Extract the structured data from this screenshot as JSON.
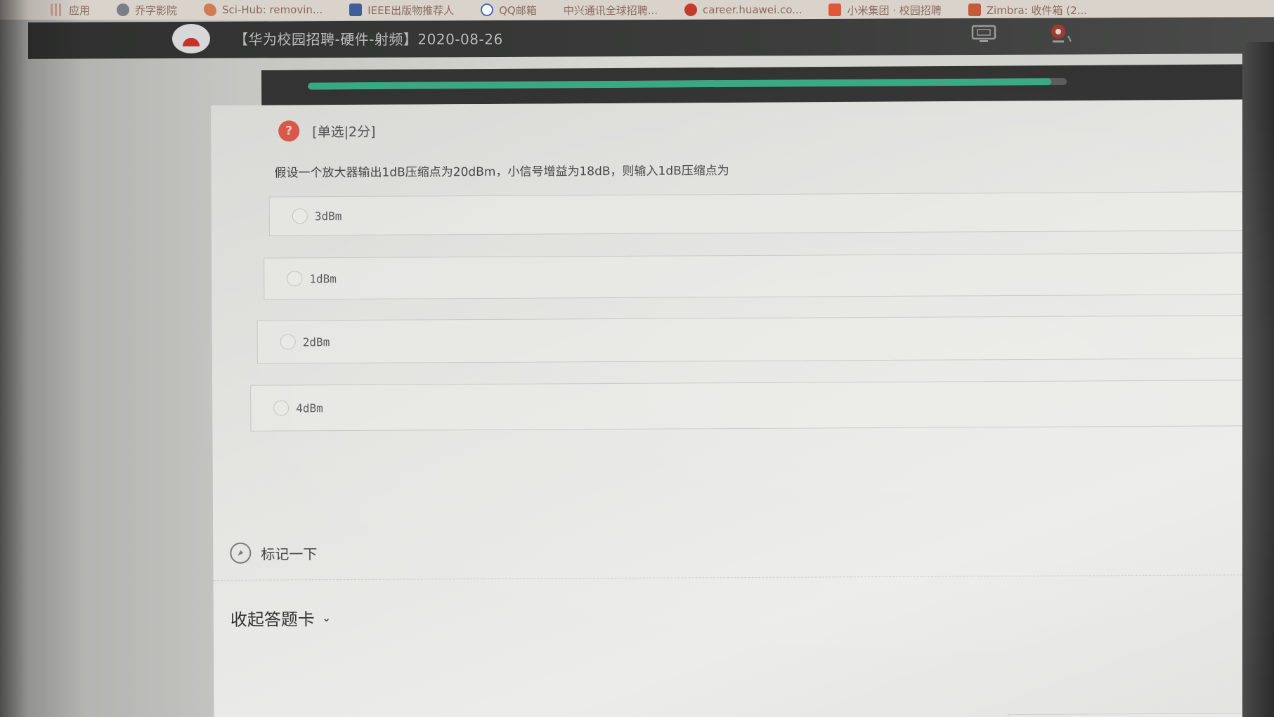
{
  "bookmarks": [
    {
      "label": "应用",
      "icon": "apps-grid-icon"
    },
    {
      "label": "乔字影院",
      "icon": "globe-icon"
    },
    {
      "label": "Sci-Hub: removin...",
      "icon": "scihub-icon"
    },
    {
      "label": "IEEE出版物推荐人",
      "icon": "ieee-icon"
    },
    {
      "label": "QQ邮箱",
      "icon": "qq-mail-icon"
    },
    {
      "label": "中兴通讯全球招聘...",
      "icon": "zte-icon"
    },
    {
      "label": "career.huawei.co...",
      "icon": "huawei-icon"
    },
    {
      "label": "小米集团 · 校园招聘",
      "icon": "mi-icon"
    },
    {
      "label": "Zimbra: 收件箱 (2...",
      "icon": "zimbra-icon"
    }
  ],
  "header": {
    "title": "【华为校园招聘-硬件-射频】2020-08-26",
    "logo_text": "HUAWEI"
  },
  "progress": {
    "fraction": 0.98
  },
  "question": {
    "badge": "?",
    "type_label": "[单选|2分]",
    "text": "假设一个放大器输出1dB压缩点为20dBm，小信号增益为18dB，则输入1dB压缩点为",
    "options": [
      {
        "label": "3dBm",
        "selected": false
      },
      {
        "label": "1dBm",
        "selected": false
      },
      {
        "label": "2dBm",
        "selected": false
      },
      {
        "label": "4dBm",
        "selected": false
      }
    ]
  },
  "mark_label": "标记一下",
  "collapse_label": "收起答题卡",
  "colors": {
    "accent_green": "#39a983",
    "header_dark": "#323332",
    "badge_red": "#d8584a"
  }
}
